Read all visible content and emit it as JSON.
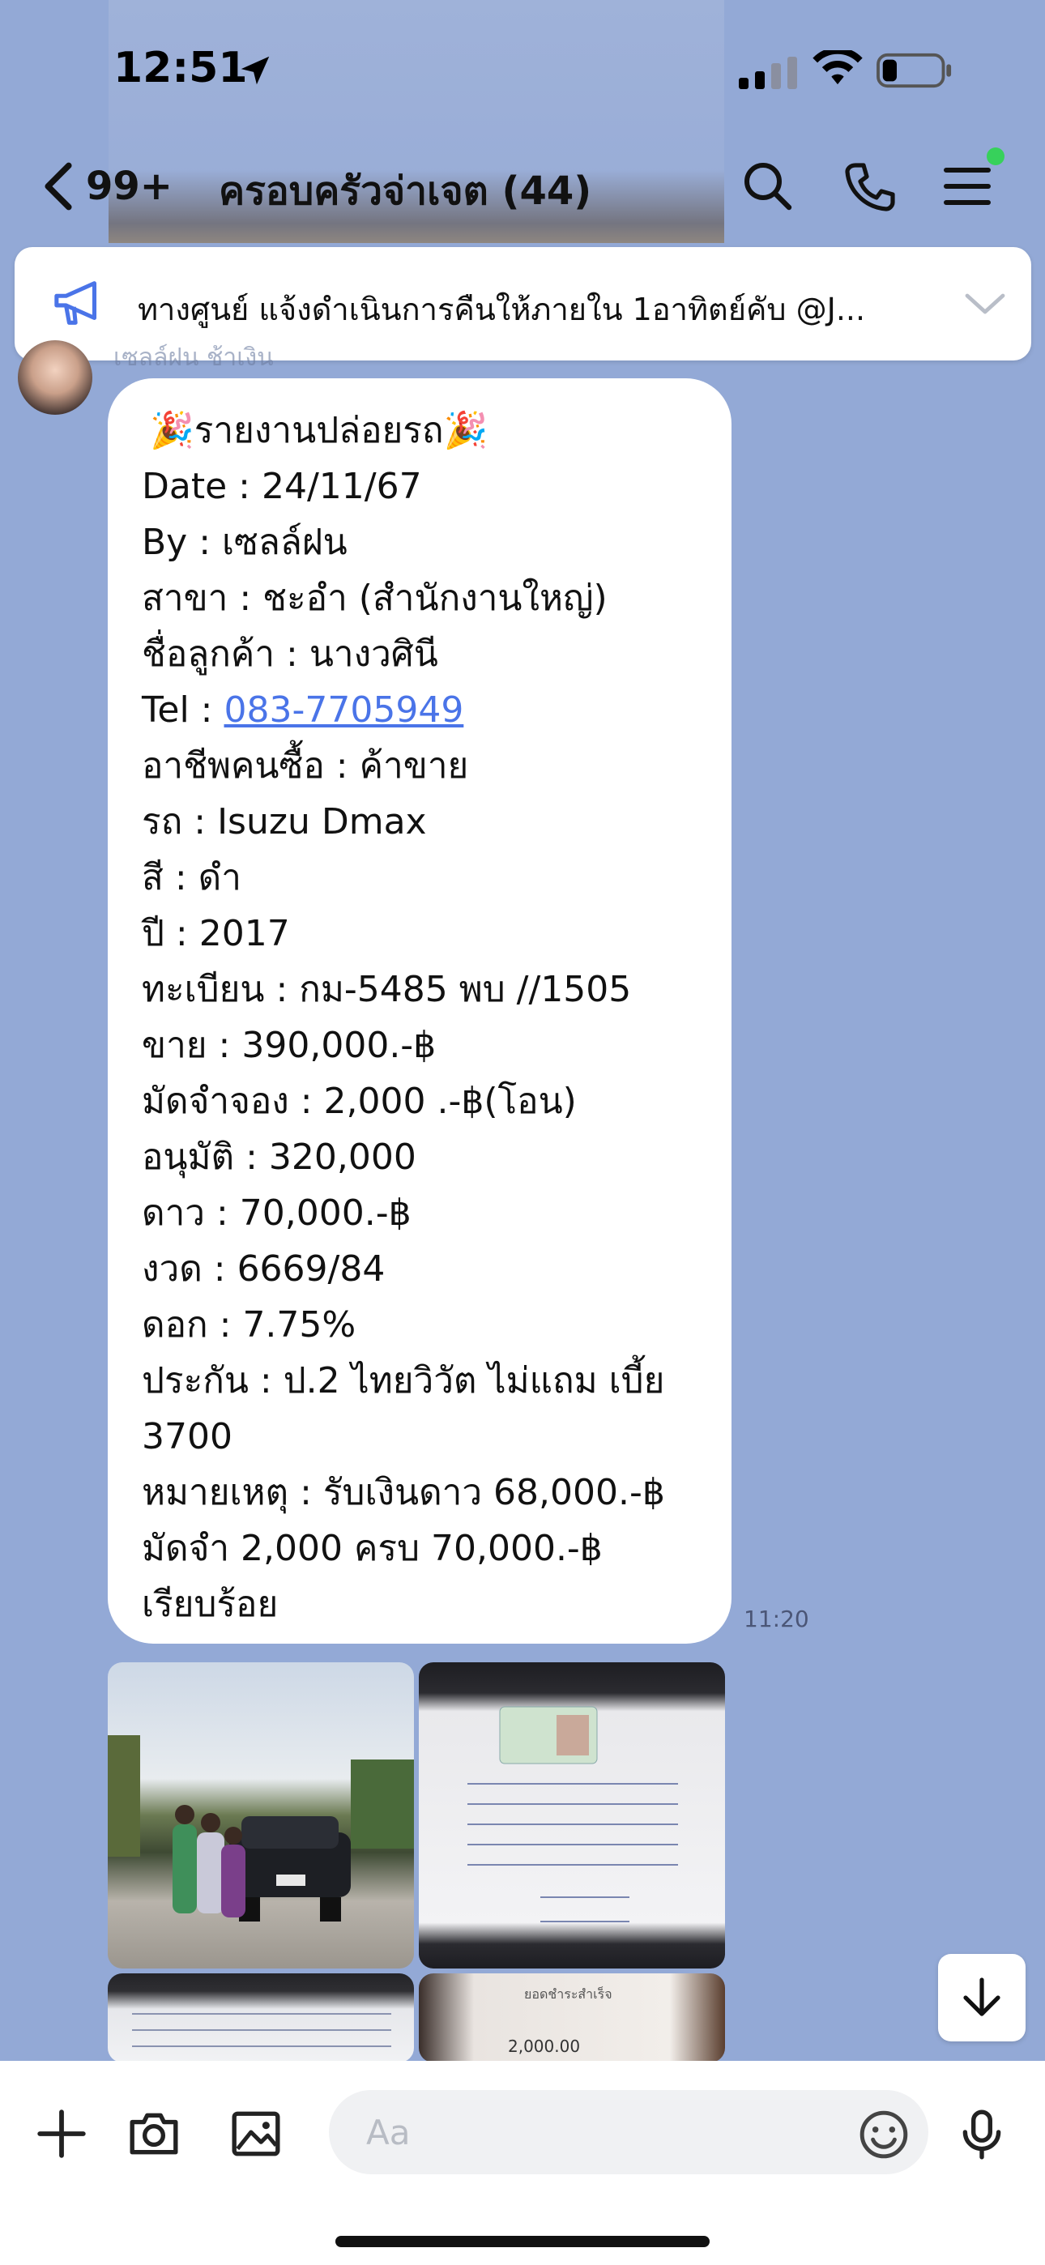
{
  "status_bar": {
    "time": "12:51"
  },
  "header": {
    "back_count": "99+",
    "title": "ครอบครัวจ่าเจต (44)"
  },
  "announcement": {
    "text": "ทางศูนย์ แจ้งดำเนินการคืนให้ภายใน 1อาทิตย์คับ @J..."
  },
  "message": {
    "sender_name": "เซลล์ฝน ช้าเงิน",
    "time": "11:20",
    "lines": [
      {
        "emoji_left": "🎉",
        "text": "รายงานปล่อยรถ",
        "emoji_right": "🎉"
      },
      {
        "text": "Date : 24/11/67"
      },
      {
        "text": "By : เซลล์ฝน"
      },
      {
        "text": "สาขา : ชะอำ (สำนักงานใหญ่)"
      },
      {
        "text": "ชื่อลูกค้า : นางวศินี"
      },
      {
        "label": "Tel : ",
        "link": "083-7705949"
      },
      {
        "text": "อาชีพคนซื้อ : ค้าขาย"
      },
      {
        "text": "รถ : Isuzu Dmax"
      },
      {
        "text": "สี : ดำ"
      },
      {
        "text": "ปี : 2017"
      },
      {
        "text": "ทะเบียน : กม-5485 พบ //1505"
      },
      {
        "text": "ขาย : 390,000.-฿"
      },
      {
        "text": "มัดจำจอง : 2,000 .-฿(โอน)"
      },
      {
        "text": "อนุมัติ : 320,000"
      },
      {
        "text": "ดาว : 70,000.-฿"
      },
      {
        "text": "งวด : 6669/84"
      },
      {
        "text": "ดอก : 7.75%"
      },
      {
        "text": "ประกัน : ป.2 ไทยวิวัต ไม่แถม เบี้ย"
      },
      {
        "text": "3700"
      },
      {
        "text": "หมายเหตุ : รับเงินดาว 68,000.-฿"
      },
      {
        "text": "มัดจำ 2,000 ครบ 70,000.-฿"
      },
      {
        "text": "เรียบร้อย"
      }
    ]
  },
  "photos": {
    "photo4_head": "ยอดชำระสำเร็จ",
    "photo4_amount": "2,000.00"
  },
  "composer": {
    "placeholder": "Aa"
  },
  "colors": {
    "background": "#93a9d6",
    "link": "#4a74e8",
    "online_dot": "#37d15b"
  }
}
